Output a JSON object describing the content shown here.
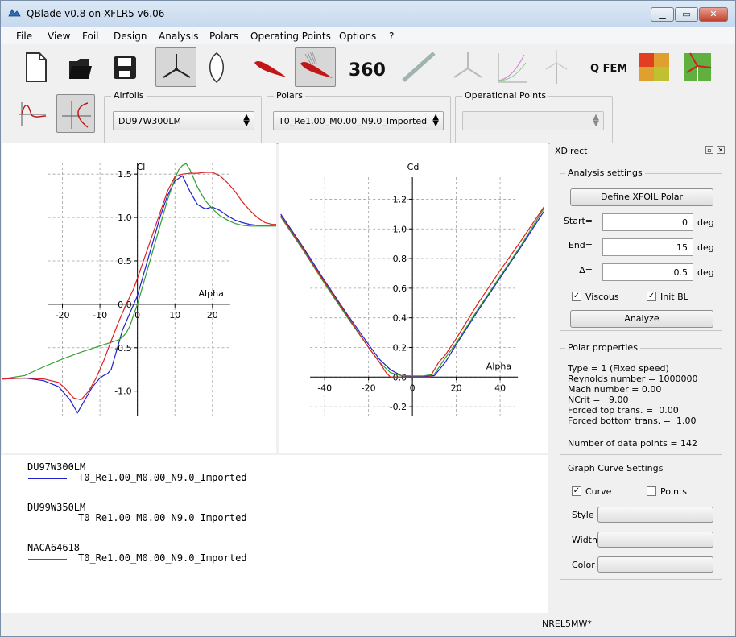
{
  "window": {
    "title": "QBlade v0.8 on XFLR5 v6.06",
    "minimize_glyph": "▁",
    "maximize_glyph": "▭",
    "close_glyph": "✕"
  },
  "menu": [
    "File",
    "View",
    "Foil",
    "Design",
    "Analysis",
    "Polars",
    "Operating Points",
    "Options",
    "?"
  ],
  "toolbar": {
    "buttons": [
      "new-file",
      "open-folder",
      "save",
      "blade-design",
      "airfoil-outline",
      "airfoil-design",
      "xfoil-analysis",
      "polar-360",
      "blade-shape",
      "rotor-simulation",
      "multi-parameter",
      "turbine-definition",
      "qfem",
      "field-view",
      "turbine-simulation"
    ],
    "active": [
      "blade-design",
      "xfoil-analysis"
    ],
    "label_360": "360°",
    "label_qfem": "Q FEM"
  },
  "selectors": {
    "airfoils": {
      "title": "Airfoils",
      "value": "DU97W300LM"
    },
    "polars": {
      "title": "Polars",
      "value": "T0_Re1.00_M0.00_N9.0_Imported"
    },
    "oppoints": {
      "title": "Operational Points",
      "value": ""
    }
  },
  "colors": {
    "du97": "#2020d0",
    "du99": "#30a030",
    "naca": "#e02020",
    "axis": "#000000",
    "grid": "#a0a0a0"
  },
  "chart_data": [
    {
      "type": "line",
      "title": "Cl",
      "xlabel": "Alpha",
      "ylabel": "",
      "xlim": [
        -36,
        37
      ],
      "ylim": [
        -1.3,
        1.65
      ],
      "xticks": [
        -20,
        -10,
        0,
        10,
        20
      ],
      "xtick_labels": [
        "-20",
        "-10",
        "0",
        "10",
        "20"
      ],
      "yticks": [
        -1.0,
        -0.5,
        0.0,
        0.5,
        1.0,
        1.5
      ],
      "ytick_labels": [
        "-1.0",
        "-0.5",
        "0.0",
        "0.5",
        "1.0",
        "1.5"
      ],
      "grid": true,
      "series": [
        {
          "name": "DU97W300LM",
          "x": [
            -36,
            -30,
            -25,
            -21,
            -18,
            -16,
            -14,
            -12,
            -10,
            -9,
            -8,
            -7,
            -6,
            -5,
            -4,
            -2,
            0,
            2,
            4,
            6,
            8,
            10,
            12,
            14,
            16,
            18,
            20,
            22,
            24,
            26,
            28,
            30,
            32,
            34,
            36,
            37
          ],
          "y": [
            -0.86,
            -0.85,
            -0.88,
            -0.95,
            -1.1,
            -1.25,
            -1.1,
            -0.95,
            -0.85,
            -0.82,
            -0.8,
            -0.75,
            -0.6,
            -0.45,
            -0.3,
            -0.1,
            0.1,
            0.4,
            0.7,
            1.0,
            1.25,
            1.42,
            1.48,
            1.3,
            1.15,
            1.1,
            1.12,
            1.08,
            1.02,
            0.97,
            0.94,
            0.92,
            0.91,
            0.91,
            0.91,
            0.91
          ]
        },
        {
          "name": "DU99W350LM",
          "x": [
            -36,
            -30,
            -25,
            -20,
            -15,
            -10,
            -5,
            -4,
            -3,
            -2,
            -1,
            0,
            2,
            4,
            6,
            8,
            10,
            11,
            12,
            13,
            14,
            16,
            18,
            20,
            22,
            24,
            26,
            28,
            30,
            32,
            34,
            36,
            37
          ],
          "y": [
            -0.86,
            -0.82,
            -0.72,
            -0.63,
            -0.55,
            -0.48,
            -0.41,
            -0.38,
            -0.33,
            -0.25,
            -0.12,
            0.0,
            0.3,
            0.6,
            0.9,
            1.2,
            1.45,
            1.55,
            1.6,
            1.62,
            1.55,
            1.35,
            1.2,
            1.1,
            1.02,
            0.97,
            0.93,
            0.91,
            0.9,
            0.9,
            0.9,
            0.9,
            0.9
          ]
        },
        {
          "name": "NACA64618",
          "x": [
            -36,
            -30,
            -25,
            -21,
            -19,
            -17,
            -15,
            -13,
            -11,
            -9,
            -7,
            -5,
            -3,
            -1,
            0,
            2,
            4,
            6,
            8,
            10,
            12,
            14,
            16,
            18,
            20,
            22,
            24,
            26,
            28,
            30,
            32,
            34,
            36,
            37
          ],
          "y": [
            -0.86,
            -0.85,
            -0.86,
            -0.9,
            -0.98,
            -1.08,
            -1.1,
            -1.0,
            -0.85,
            -0.65,
            -0.42,
            -0.2,
            0.0,
            0.18,
            0.3,
            0.55,
            0.8,
            1.05,
            1.3,
            1.47,
            1.5,
            1.51,
            1.51,
            1.52,
            1.52,
            1.48,
            1.4,
            1.3,
            1.18,
            1.08,
            1.0,
            0.94,
            0.92,
            0.92
          ]
        }
      ]
    },
    {
      "type": "line",
      "title": "Cd",
      "xlabel": "Alpha",
      "ylabel": "",
      "xlim": [
        -61,
        62
      ],
      "ylim": [
        -0.27,
        1.36
      ],
      "xticks": [
        -40,
        -20,
        0,
        20,
        40
      ],
      "xtick_labels": [
        "-40",
        "-20",
        "0",
        "20",
        "40"
      ],
      "yticks": [
        -0.2,
        0.0,
        0.2,
        0.4,
        0.6,
        0.8,
        1.0,
        1.2
      ],
      "ytick_labels": [
        "-0.2",
        "0.0",
        "0.2",
        "0.4",
        "0.6",
        "0.8",
        "1.0",
        "1.2"
      ],
      "grid": true,
      "series": [
        {
          "name": "DU97W300LM",
          "x": [
            -60,
            -50,
            -40,
            -30,
            -20,
            -15,
            -10,
            -5,
            0,
            5,
            10,
            15,
            20,
            30,
            40,
            50,
            60
          ],
          "y": [
            1.1,
            0.88,
            0.65,
            0.43,
            0.22,
            0.12,
            0.05,
            0.01,
            0.005,
            0.005,
            0.01,
            0.1,
            0.22,
            0.45,
            0.67,
            0.89,
            1.12
          ]
        },
        {
          "name": "DU99W350LM",
          "x": [
            -60,
            -50,
            -40,
            -30,
            -20,
            -15,
            -10,
            -5,
            0,
            5,
            10,
            15,
            20,
            30,
            40,
            50,
            60
          ],
          "y": [
            1.08,
            0.86,
            0.63,
            0.41,
            0.2,
            0.1,
            0.03,
            0.01,
            0.008,
            0.008,
            0.02,
            0.13,
            0.23,
            0.46,
            0.68,
            0.9,
            1.14
          ]
        },
        {
          "name": "NACA64618",
          "x": [
            -60,
            -50,
            -40,
            -30,
            -20,
            -15,
            -12,
            -10,
            -8,
            0,
            8,
            10,
            12,
            15,
            20,
            30,
            40,
            50,
            60
          ],
          "y": [
            1.09,
            0.87,
            0.64,
            0.42,
            0.2,
            0.1,
            0.03,
            0.0,
            0.0,
            0.0,
            0.0,
            0.05,
            0.1,
            0.15,
            0.26,
            0.5,
            0.72,
            0.93,
            1.15
          ]
        }
      ]
    }
  ],
  "legend": {
    "polar_name": "T0_Re1.00_M0.00_N9.0_Imported",
    "entries": [
      {
        "foil": "DU97W300LM",
        "polar": "T0_Re1.00_M0.00_N9.0_Imported"
      },
      {
        "foil": "DU99W350LM",
        "polar": "T0_Re1.00_M0.00_N9.0_Imported"
      },
      {
        "foil": "NACA64618",
        "polar": "T0_Re1.00_M0.00_N9.0_Imported"
      }
    ]
  },
  "xdirect": {
    "title": "XDirect",
    "analysis": {
      "title": "Analysis settings",
      "define_button": "Define XFOIL Polar",
      "start_label": "Start=",
      "start_value": "0",
      "start_unit": "deg",
      "end_label": "End=",
      "end_value": "15",
      "end_unit": "deg",
      "delta_label": "Δ=",
      "delta_value": "0.5",
      "delta_unit": "deg",
      "viscous_label": "Viscous",
      "viscous_checked": true,
      "initbl_label": "Init BL",
      "initbl_checked": true,
      "analyze_button": "Analyze"
    },
    "polar_props": {
      "title": "Polar properties",
      "lines": [
        "Type = 1 (Fixed speed)",
        "Reynolds number = 1000000",
        "Mach number = 0.00",
        "NCrit =   9.00",
        "Forced top trans. =  0.00",
        "Forced bottom trans. =  1.00",
        "",
        "Number of data points = 142"
      ]
    },
    "curve_settings": {
      "title": "Graph Curve Settings",
      "curve_label": "Curve",
      "curve_checked": true,
      "points_label": "Points",
      "points_checked": false,
      "style_label": "Style",
      "width_label": "Width",
      "color_label": "Color"
    }
  },
  "status": {
    "project": "NREL5MW*"
  }
}
